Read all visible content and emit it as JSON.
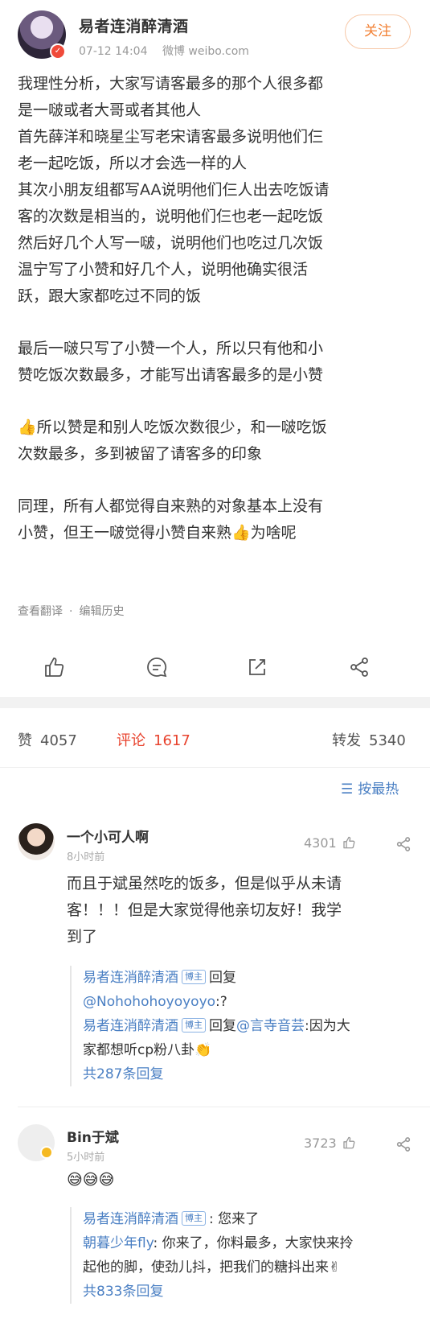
{
  "post": {
    "author_name": "易者连消醉清酒",
    "date": "07-12 14:04",
    "source": "微博 weibo.com",
    "follow_label": "关注",
    "body": [
      "我理性分析，大家写请客最多的那个人很多都",
      "是一啵或者大哥或者其他人",
      "首先薛洋和晓星尘写老宋请客最多说明他们仨",
      "老一起吃饭，所以才会选一样的人",
      "其次小朋友组都写AA说明他们仨人出去吃饭请",
      "客的次数是相当的，说明他们仨也老一起吃饭",
      "然后好几个人写一啵，说明他们也吃过几次饭",
      "温宁写了小赞和好几个人，说明他确实很活",
      "跃，跟大家都吃过不同的饭",
      "",
      "最后一啵只写了小赞一个人，所以只有他和小",
      "赞吃饭次数最多，才能写出请客最多的是小赞",
      "",
      "👍所以赞是和别人吃饭次数很少，和一啵吃饭",
      "次数最多，多到被留了请客多的印象",
      "",
      "同理，所有人都觉得自来熟的对象基本上没有",
      "小赞，但王一啵觉得小赞自来熟👍为啥呢"
    ],
    "translate_label": "查看翻译",
    "edit_history_label": "编辑历史"
  },
  "stats": {
    "like_label": "赞",
    "like_count": "4057",
    "comment_label": "评论",
    "comment_count": "1617",
    "repost_label": "转发",
    "repost_count": "5340"
  },
  "sort": {
    "label": "按最热",
    "icon": "sort-icon"
  },
  "comments": [
    {
      "name": "一个小可人啊",
      "time": "8小时前",
      "likes": "4301",
      "text": [
        "而且于斌虽然吃的饭多，但是似乎从未请",
        "客！！！但是大家觉得他亲切友好！我学",
        "到了"
      ],
      "replies": [
        {
          "name": "易者连消醉清酒",
          "tag": "博主",
          "pre": "回复",
          "at": "",
          "text": ""
        },
        {
          "name": "",
          "tag": "",
          "pre": "",
          "at": "@Nohohohoyoyoyo",
          "text": ":?"
        },
        {
          "name": "易者连消醉清酒",
          "tag": "博主",
          "pre": "回复",
          "at": "@言寺音芸",
          "text": ":因为大"
        },
        {
          "name": "",
          "tag": "",
          "pre": "",
          "at": "",
          "text": "家都想听cp粉八卦👏"
        }
      ],
      "more": "共287条回复"
    },
    {
      "name": "Bin于斌",
      "time": "5小时前",
      "likes": "3723",
      "text": [
        "😅😅😅"
      ],
      "replies": [
        {
          "name": "易者连消醉清酒",
          "tag": "博主",
          "pre": "",
          "at": "",
          "text": ": 您来了"
        },
        {
          "name": "朝暮少年fly",
          "tag": "",
          "pre": "",
          "at": "",
          "text": ": 你来了，你料最多，大家快来拎"
        },
        {
          "name": "",
          "tag": "",
          "pre": "",
          "at": "",
          "text": "起他的脚，使劲儿抖，把我们的糖抖出来✌"
        }
      ],
      "more": "共833条回复"
    }
  ],
  "colors": {
    "accent": "#e8432e",
    "link": "#4a7fc3",
    "follow": "#f28135"
  }
}
